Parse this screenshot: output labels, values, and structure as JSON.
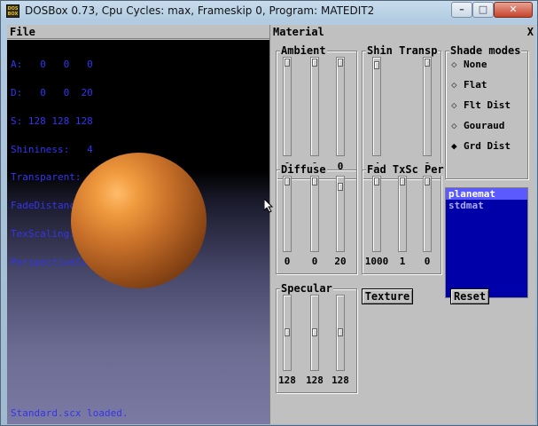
{
  "window": {
    "title": "DOSBox 0.73, Cpu Cycles:      max, Frameskip  0, Program: MATEDIT2",
    "app_icon_text": "DOS BOX",
    "buttons": {
      "minimize": "–",
      "maximize": "□",
      "close": "✕"
    }
  },
  "viewport": {
    "menu_file": "File",
    "readout": [
      "A:   0   0   0",
      "D:   0   0  20",
      "S: 128 128 128",
      "Shininess:   4",
      "Transparent:   0",
      "FadeDistance:1000",
      "TexScaling:   1",
      "PerspectiveCorrect:   0"
    ],
    "status": "Standard.scx loaded."
  },
  "material": {
    "title": "Material",
    "close_glyph": "X",
    "ambient": {
      "label": "Ambient",
      "values": [
        "0",
        "0",
        "0"
      ],
      "levels": [
        0,
        0,
        0
      ]
    },
    "shin_transp": {
      "label": "Shin Transp",
      "values": [
        "4",
        "0"
      ],
      "levels": [
        0.03,
        0
      ]
    },
    "shade_modes": {
      "label": "Shade modes",
      "options": [
        "None",
        "Flat",
        "Flt Dist",
        "Gouraud",
        "Grd Dist"
      ],
      "selected": "Grd Dist"
    },
    "diffuse": {
      "label": "Diffuse",
      "values": [
        "0",
        "0",
        "20"
      ],
      "levels": [
        0,
        0,
        0.08
      ]
    },
    "fad_txsc_per": {
      "label": "Fad TxSc Per",
      "values": [
        "1000",
        "1",
        "0"
      ],
      "levels": [
        0,
        0,
        0
      ]
    },
    "materials": {
      "items": [
        "planemat",
        "stdmat"
      ],
      "selected": "planemat"
    },
    "specular": {
      "label": "Specular",
      "values": [
        "128",
        "128",
        "128"
      ],
      "levels": [
        0.5,
        0.5,
        0.5
      ]
    },
    "texture_button": "Texture",
    "reset_button": "Reset"
  }
}
